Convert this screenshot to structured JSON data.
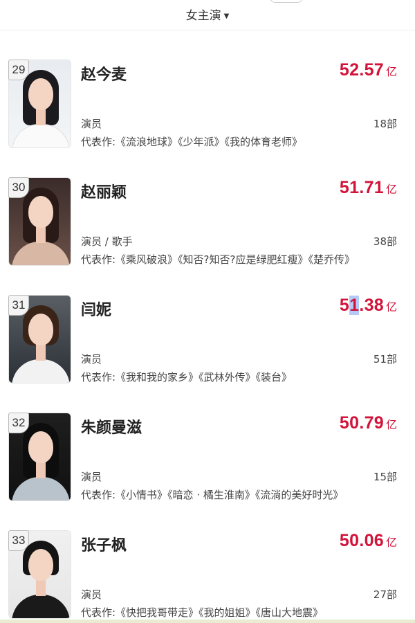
{
  "header": {
    "dropdown_label": "女主演",
    "caret": "▼"
  },
  "items": [
    {
      "rank": "29",
      "name": "赵今麦",
      "box_value": "52.57",
      "box_unit": "亿",
      "role": "演员",
      "count": "18部",
      "works": "代表作:《流浪地球》《少年派》《我的体育老师》"
    },
    {
      "rank": "30",
      "name": "赵丽颖",
      "box_value": "51.71",
      "box_unit": "亿",
      "role": "演员 / 歌手",
      "count": "38部",
      "works": "代表作:《乘风破浪》《知否?知否?应是绿肥红瘦》《楚乔传》"
    },
    {
      "rank": "31",
      "name": "闫妮",
      "box_value_pre": "5",
      "box_value_hl": "1",
      "box_value_post": ".38",
      "box_unit": "亿",
      "role": "演员",
      "count": "51部",
      "works": "代表作:《我和我的家乡》《武林外传》《装台》"
    },
    {
      "rank": "32",
      "name": "朱颜曼滋",
      "box_value": "50.79",
      "box_unit": "亿",
      "role": "演员",
      "count": "15部",
      "works": "代表作:《小情书》《暗恋 · 橘生淮南》《流淌的美好时光》"
    },
    {
      "rank": "33",
      "name": "张子枫",
      "box_value": "50.06",
      "box_unit": "亿",
      "role": "演员",
      "count": "27部",
      "works": "代表作:《快把我哥带走》《我的姐姐》《唐山大地震》"
    }
  ],
  "colors": {
    "accent": "#d2143a",
    "text": "#222222",
    "muted": "#444444"
  }
}
